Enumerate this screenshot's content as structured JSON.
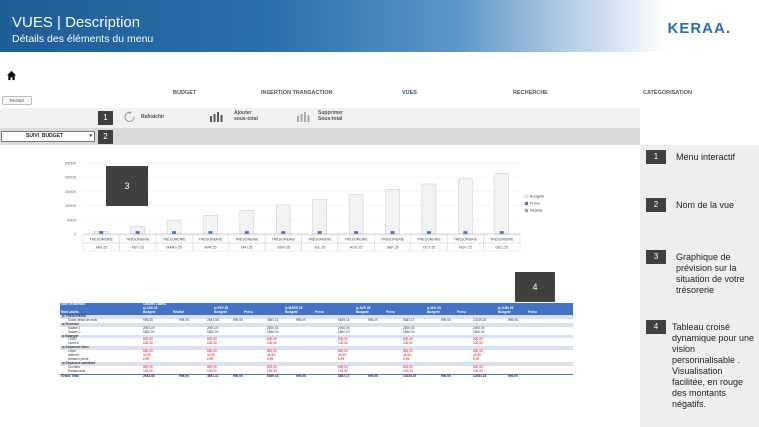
{
  "header": {
    "title": "VUES | Description",
    "subtitle": "Détails des éléments du menu",
    "logo": "KERAA."
  },
  "nav": {
    "home_icon": "home-icon",
    "items": [
      "BUDGET",
      "INSERTION TRANSACTION",
      "VUES",
      "RECHERCHE",
      "CATÉGORISATION"
    ],
    "active": "VUES",
    "restart": "Restart"
  },
  "ribbon": {
    "refresh": "Rafraichir",
    "add_subtotal_1": "Ajouter",
    "add_subtotal_2": "sous-total",
    "remove_subtotal_1": "Supprimer",
    "remove_subtotal_2": "Sous-total",
    "dropdown_value": "SUIVI_BUDGET",
    "box1": "1",
    "box2": "2"
  },
  "chart_data": {
    "type": "bar",
    "categories": [
      "JAN 25",
      "FEV 25",
      "MARS 25",
      "AVR 25",
      "MAI 25",
      "JUIN 25",
      "JUL 25",
      "AOU 25",
      "SEP 25",
      "OCT 25",
      "NOV 25",
      "DEC 25"
    ],
    "category_top_label": "TRÉSORERIE",
    "series": [
      {
        "name": "Budgété",
        "values": [
          995,
          2643,
          4691,
          6539,
          8387,
          10235,
          12083,
          13931,
          15779,
          17627,
          19475,
          21323
        ]
      },
      {
        "name": "Prévu",
        "values": [
          995,
          995,
          995,
          995,
          995,
          995,
          995,
          995,
          995,
          995,
          995,
          995
        ]
      },
      {
        "name": "Réalisé",
        "values": [
          0,
          0,
          0,
          0,
          0,
          0,
          0,
          0,
          0,
          0,
          0,
          0
        ]
      }
    ],
    "ylim": [
      0,
      25000
    ],
    "yticks": [
      "25000",
      "20000",
      "15000",
      "10000",
      "5000",
      "0"
    ],
    "legend_position": "right",
    "colors": {
      "budgete": "#f2f2f2",
      "prevu": "#4472c4",
      "realise": "#a5a5a5"
    }
  },
  "overlays": {
    "box3": "3",
    "box4": "4"
  },
  "right_panel": [
    {
      "num": "1",
      "text": "Menu interactif"
    },
    {
      "num": "2",
      "text": "Nom de la vue"
    },
    {
      "num": "3",
      "text": "Graphique de prévision sur la situation de votre trésorerie"
    },
    {
      "num": "4",
      "text": "Tableau croisé dynamique pour une vision personnalisable . Visualisation facilitée, en rouge des montants négatifs."
    }
  ],
  "pivot": {
    "header1": [
      "Sum of Montant",
      "Column Labels"
    ],
    "months": [
      "JAN 25",
      "FEV 25",
      "MARS 25",
      "AVR 25",
      "MAI 25",
      "JUIN 25"
    ],
    "sub_headers": [
      "Budgeté",
      "Réalisé",
      "Prévu"
    ],
    "row_label_header": "Row Labels",
    "rows": [
      {
        "label": "TRÉSORERIE",
        "type": "section",
        "vals": []
      },
      {
        "label": "Solde début de mois",
        "type": "item",
        "vals": [
          "995,05",
          "995,05",
          "2643,08",
          "995,05",
          "4691,11",
          "995,05",
          "6539,14",
          "995,05",
          "8387,17",
          "995,05",
          "10235,20",
          "995,05"
        ]
      },
      {
        "label": "Revenus",
        "type": "section",
        "vals": []
      },
      {
        "label": "Salaire 1",
        "type": "item",
        "vals": [
          "2000,00",
          "",
          "2000,00",
          "",
          "2000,00",
          "",
          "2000,00",
          "",
          "2000,00",
          "",
          "2000,00",
          ""
        ]
      },
      {
        "label": "Salaire 2",
        "type": "item",
        "vals": [
          "1800,00",
          "",
          "1800,00",
          "",
          "1800,00",
          "",
          "1800,00",
          "",
          "1800,00",
          "",
          "1800,00",
          ""
        ]
      },
      {
        "label": "Epargne",
        "type": "section",
        "vals": []
      },
      {
        "label": "LDDS",
        "type": "neg",
        "vals": [
          "600,00",
          "",
          "600,00",
          "",
          "600,00",
          "",
          "600,00",
          "",
          "600,00",
          "",
          "600,00",
          ""
        ]
      },
      {
        "label": "Livret A",
        "type": "neg",
        "vals": [
          "100,00",
          "",
          "100,00",
          "",
          "100,00",
          "",
          "100,00",
          "",
          "100,00",
          "",
          "100,00",
          ""
        ]
      },
      {
        "label": "Dépenses fixes",
        "type": "section",
        "vals": []
      },
      {
        "label": "Loyer",
        "type": "neg",
        "vals": [
          "800,00",
          "",
          "800,00",
          "",
          "800,00",
          "",
          "800,00",
          "",
          "800,00",
          "",
          "800,00",
          ""
        ]
      },
      {
        "label": "Internet",
        "type": "neg",
        "vals": [
          "44,99",
          "",
          "44,99",
          "",
          "44,99",
          "",
          "44,99",
          "",
          "44,99",
          "",
          "44,99",
          ""
        ]
      },
      {
        "label": "Amazon prime",
        "type": "neg",
        "vals": [
          "6,99",
          "",
          "6,99",
          "",
          "6,99",
          "",
          "6,99",
          "",
          "6,99",
          "",
          "6,99",
          ""
        ]
      },
      {
        "label": "Dépenses variables",
        "type": "section",
        "vals": []
      },
      {
        "label": "Courses",
        "type": "neg",
        "vals": [
          "500,00",
          "",
          "500,00",
          "",
          "500,00",
          "",
          "500,00",
          "",
          "500,00",
          "",
          "500,00",
          ""
        ]
      },
      {
        "label": "Restaurants",
        "type": "neg",
        "vals": [
          "100,00",
          "",
          "100,00",
          "",
          "100,00",
          "",
          "100,00",
          "",
          "100,00",
          "",
          "100,00",
          ""
        ]
      },
      {
        "label": "Grand Total",
        "type": "total",
        "vals": [
          "2643,08",
          "995,05",
          "4691,11",
          "995,05",
          "6539,14",
          "995,05",
          "8387,17",
          "995,05",
          "10235,20",
          "995,05",
          "12083,23",
          "995,05"
        ]
      }
    ]
  }
}
